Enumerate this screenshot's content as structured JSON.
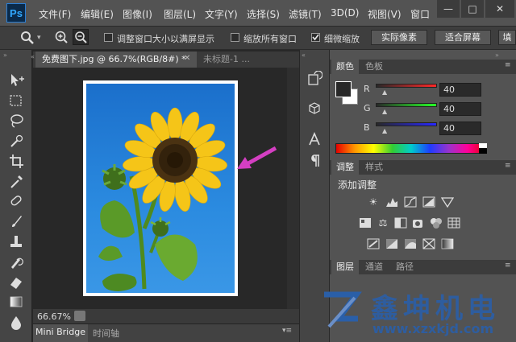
{
  "app": {
    "logo": "Ps"
  },
  "menu": [
    "文件(F)",
    "编辑(E)",
    "图像(I)",
    "图层(L)",
    "文字(Y)",
    "选择(S)",
    "滤镜(T)",
    "3D(D)",
    "视图(V)",
    "窗口"
  ],
  "window_controls": {
    "minimize": "—",
    "maximize": "□",
    "close": "✕"
  },
  "options_bar": {
    "fit_window": "调整窗口大小以满屏显示",
    "zoom_all": "缩放所有窗口",
    "scrubby_zoom": "细微缩放",
    "scrubby_checked": true,
    "actual_pixels": "实际像素",
    "fit_screen": "适合屏幕",
    "fill_screen": "填"
  },
  "document": {
    "tab_active": "免费图下.jpg @ 66.7%(RGB/8#) *",
    "tab_inactive": "未标题-1 ...",
    "zoom": "66.67%"
  },
  "bottom_tabs": [
    "Mini Bridge",
    "时间轴"
  ],
  "color_panel": {
    "tabs": [
      "颜色",
      "色板"
    ],
    "channels": [
      {
        "label": "R",
        "value": "40",
        "color": "#e03a3a"
      },
      {
        "label": "G",
        "value": "40",
        "color": "#2fbf3f"
      },
      {
        "label": "B",
        "value": "40",
        "color": "#3a4fe0"
      }
    ]
  },
  "adjustments_panel": {
    "tabs": [
      "调整",
      "样式"
    ],
    "title": "添加调整"
  },
  "layers_panel": {
    "tabs": [
      "图层",
      "通道",
      "路径"
    ]
  },
  "watermark": {
    "brand": "鑫坤机电",
    "url": "www.xzxkjd.com"
  },
  "colors": {
    "arrow": "#d43fc2",
    "brand_blue": "#2a5fa8"
  }
}
